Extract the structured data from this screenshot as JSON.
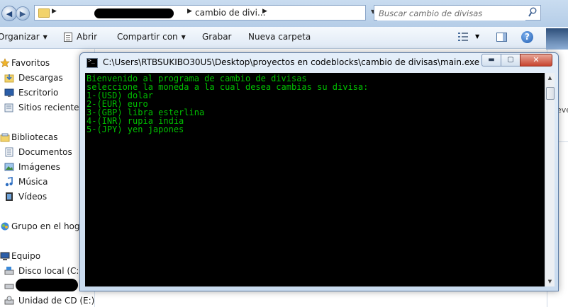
{
  "explorer": {
    "address": {
      "crumb_current": "cambio de divi...",
      "arrow": "▶",
      "arrow2": "▶",
      "arrow3": "▶",
      "drop": "▼",
      "refresh_icon": "refresh-icon"
    },
    "search": {
      "placeholder": "Buscar cambio de divisas"
    },
    "toolbar": {
      "organize": "Organizar",
      "open": "Abrir",
      "share": "Compartir con",
      "burn": "Grabar",
      "new_folder": "Nueva carpeta",
      "caret": "▼",
      "help": "?"
    },
    "nav": {
      "favorites": "Favoritos",
      "downloads": "Descargas",
      "desktop": "Escritorio",
      "recent": "Sitios recientes",
      "libraries": "Bibliotecas",
      "documents": "Documentos",
      "images": "Imágenes",
      "music": "Música",
      "videos": "Vídeos",
      "homegroup": "Grupo en el hogar",
      "computer": "Equipo",
      "local_disk": "Disco local (C:)",
      "cd_drive": "Unidad de CD (E:)"
    },
    "right_peek": "eve"
  },
  "console": {
    "title": "C:\\Users\\RTBSUKIBO30U5\\Desktop\\proyectos en codeblocks\\cambio de divisas\\main.exe",
    "buttons": {
      "minimize": "▬",
      "maximize": "▢",
      "close": "✕"
    },
    "lines": [
      "Bienvenido al programa de cambio de divisas",
      "seleccione la moneda a la cual desea cambias su divisa:",
      "1-(USD) dolar",
      "2-(EUR) euro",
      "3-(GBP) libra esterlina",
      "4-(INR) rupia india",
      "5-(JPY) yen japones"
    ],
    "text_color": "#00c000",
    "scroll": {
      "up": "▲",
      "down": "▼"
    }
  }
}
